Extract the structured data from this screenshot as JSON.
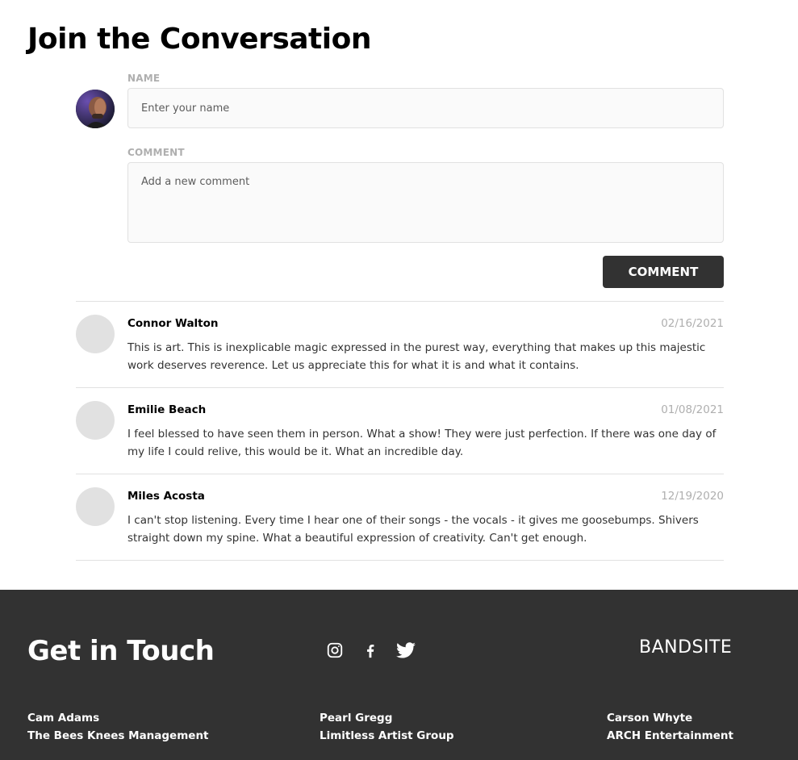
{
  "page_title": "Join the Conversation",
  "form": {
    "name_label": "NAME",
    "name_placeholder": "Enter your name",
    "comment_label": "COMMENT",
    "comment_placeholder": "Add a new comment",
    "submit_label": "COMMENT",
    "avatar_icon": "user-photo"
  },
  "comments": [
    {
      "author": "Connor Walton",
      "date": "02/16/2021",
      "text": "This is art. This is inexplicable magic expressed in the purest way, everything that makes up this majestic work deserves reverence. Let us appreciate this for what it is and what it contains."
    },
    {
      "author": "Emilie Beach",
      "date": "01/08/2021",
      "text": "I feel blessed to have seen them in person. What a show! They were just perfection. If there was one day of my life I could relive, this would be it. What an incredible day."
    },
    {
      "author": "Miles Acosta",
      "date": "12/19/2020",
      "text": "I can't stop listening. Every time I hear one of their songs - the vocals - it gives me goosebumps. Shivers straight down my spine. What a beautiful expression of creativity. Can't get enough."
    }
  ],
  "footer": {
    "title": "Get in Touch",
    "brand": "BANDSITE",
    "social": [
      "instagram-icon",
      "facebook-icon",
      "twitter-icon"
    ],
    "contacts": [
      {
        "name": "Cam Adams",
        "company": "The Bees Knees Management"
      },
      {
        "name": "Pearl Gregg",
        "company": "Limitless Artist Group"
      },
      {
        "name": "Carson Whyte",
        "company": "ARCH Entertainment"
      }
    ]
  },
  "colors": {
    "footer_bg": "#323232",
    "input_bg": "#FAFAFA",
    "border": "#E1E1E1",
    "muted_text": "#AFAFAF",
    "button_bg": "#323232"
  }
}
